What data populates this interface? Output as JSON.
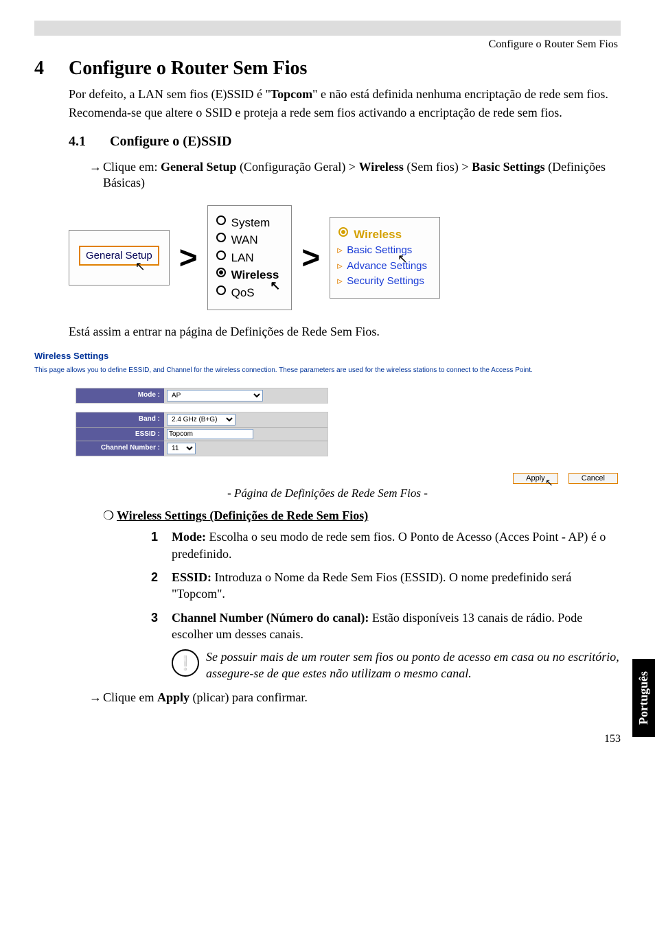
{
  "header": {
    "label": "Configure o Router Sem Fios"
  },
  "section": {
    "num": "4",
    "title": "Configure o Router Sem Fios",
    "para1a": "Por defeito, a LAN sem fios (E)SSID é \"",
    "para1bold": "Topcom",
    "para1b": "\" e não está definida nenhuma encriptação de rede sem fios.",
    "para2": "Recomenda-se que altere o SSID e proteja a rede sem fios activando a encriptação de rede sem fios."
  },
  "sub": {
    "num": "4.1",
    "title": "Configure o (E)SSID",
    "click_pre": "Clique em: ",
    "gs": "General Setup",
    "gs_after": " (Configuração Geral) > ",
    "wl": "Wireless",
    "wl_after": " (Sem fios) > ",
    "bs": "Basic Settings",
    "bs_after": " (Definições Básicas)"
  },
  "nav": {
    "general_setup": "General Setup",
    "gt": ">",
    "menu": {
      "system": "System",
      "wan": "WAN",
      "lan": "LAN",
      "wireless": "Wireless",
      "qos": "QoS"
    },
    "wireless_sub": {
      "basic": "Basic Settings",
      "adv": "Advance Settings",
      "sec": "Security Settings"
    }
  },
  "enter_text": "Está assim a entrar na página de Definições de Rede Sem Fios.",
  "ws": {
    "title": "Wireless Settings",
    "desc": "This page allows you to define ESSID, and Channel for the wireless connection. These parameters are used for the wireless stations to connect to the Access Point.",
    "rows": {
      "mode_label": "Mode :",
      "mode_val": "AP",
      "band_label": "Band :",
      "band_val": "2.4 GHz (B+G)",
      "essid_label": "ESSID :",
      "essid_val": "Topcom",
      "chan_label": "Channel Number :",
      "chan_val": "11"
    },
    "apply": "Apply",
    "cancel": "Cancel"
  },
  "caption": "- Página de Definições de Rede Sem Fios -",
  "wsh": "Wireless Settings (Definições de Rede Sem Fios)",
  "list": {
    "i1_b": "Mode:",
    "i1_t": " Escolha o seu modo de rede sem fios. O Ponto de Acesso (Acces Point - AP) é o predefinido.",
    "i2_b": "ESSID:",
    "i2_t": " Introduza o Nome da Rede Sem Fios (ESSID). O nome predefinido será \"Topcom\".",
    "i3_b": "Channel Number (Número do canal):",
    "i3_t": " Estão disponíveis 13 canais de rádio. Pode escolher um desses canais."
  },
  "note": "Se possuir mais de um router sem fios ou ponto de acesso em casa ou no escritório, assegure-se de que estes não utilizam o mesmo canal.",
  "apply_line_pre": "Clique em ",
  "apply_line_b": "Apply",
  "apply_line_post": " (plicar) para confirmar.",
  "side_tab": "Português",
  "page_num": "153"
}
